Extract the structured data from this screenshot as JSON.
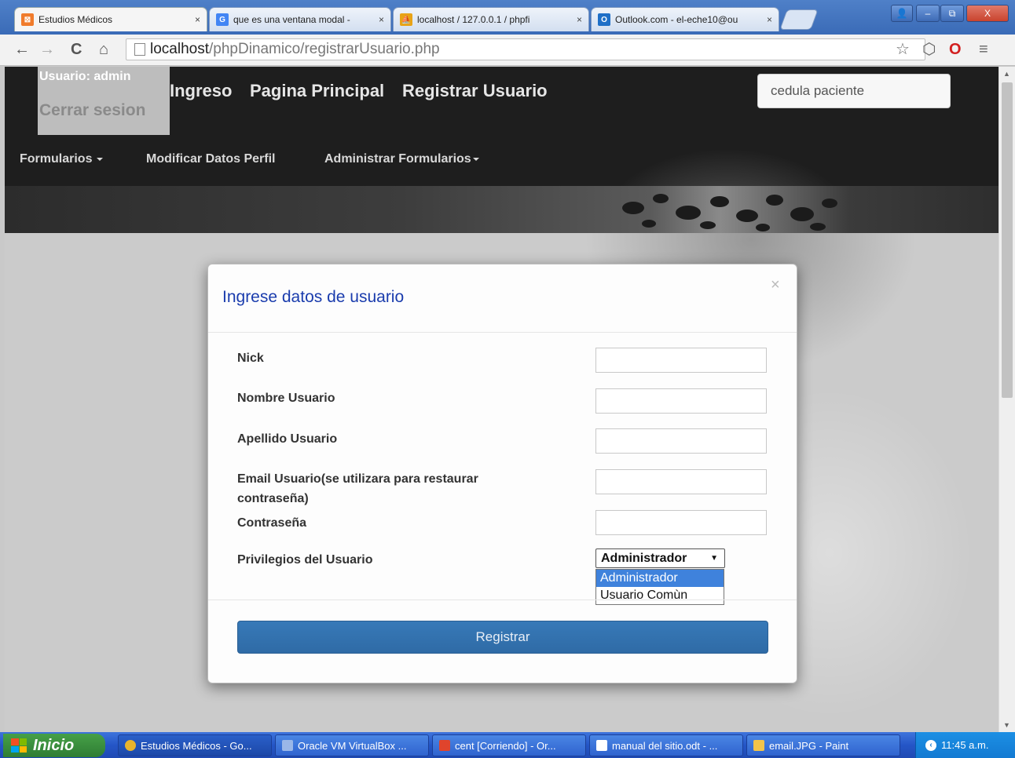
{
  "browser": {
    "tabs": [
      {
        "title": "Estudios Médicos",
        "close": "×",
        "active": true
      },
      {
        "title": "que es una ventana modal - ",
        "close": "×",
        "active": false
      },
      {
        "title": "localhost / 127.0.0.1 / phpfi",
        "close": "×",
        "active": false
      },
      {
        "title": "Outlook.com - el-eche10@ou",
        "close": "×",
        "active": false
      }
    ],
    "address": {
      "host": "localhost",
      "path": "/phpDinamico/registrarUsuario.php"
    },
    "window_buttons": {
      "minimize": "–",
      "maximize": "⧉",
      "close": "X"
    }
  },
  "header": {
    "user_label": "Usuario: admin",
    "logout": "Cerrar sesion",
    "nav": [
      "Ingreso",
      "Pagina Principal",
      "Registrar Usuario"
    ],
    "search_placeholder": "cedula paciente",
    "menu": [
      "Formularios",
      "Modificar Datos Perfil",
      "Administrar Formularios"
    ]
  },
  "modal": {
    "title": "Ingrese datos de usuario",
    "close": "×",
    "fields": [
      {
        "label": "Nick"
      },
      {
        "label": "Nombre Usuario"
      },
      {
        "label": "Apellido Usuario"
      },
      {
        "label": "Email Usuario(se utilizara para restaurar contraseña)"
      },
      {
        "label": "Contraseña"
      }
    ],
    "privileges_label": "Privilegios del Usuario",
    "privileges_selected": "Administrador",
    "privileges_options": [
      "Administrador",
      "Usuario Comùn"
    ],
    "submit": "Registrar"
  },
  "taskbar": {
    "start": "Inicio",
    "tasks": [
      "Estudios Médicos - Go...",
      "Oracle VM VirtualBox ...",
      "cent [Corriendo] - Or...",
      "manual del sitio.odt - ...",
      "email.JPG - Paint"
    ],
    "clock": "11:45 a.m."
  },
  "colors": {
    "modal_title": "#1a3cad",
    "register_button": "#337ab7",
    "selected_option": "#3f82dc",
    "taskbar": "#2556c7"
  }
}
